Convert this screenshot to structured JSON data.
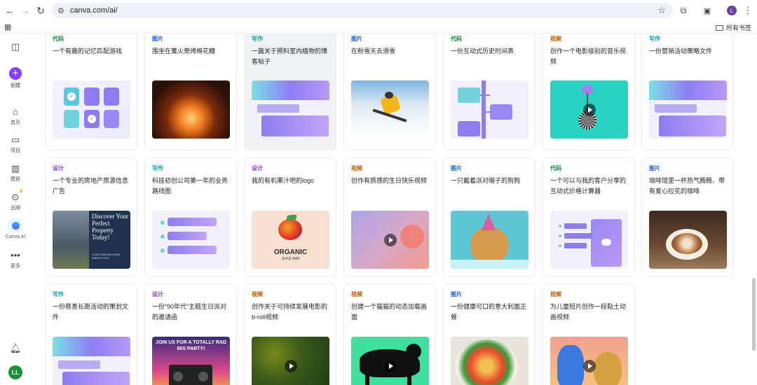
{
  "browser": {
    "url": "canva.com/ai/",
    "bookmarks_all": "所有书签",
    "profile_initial": "L"
  },
  "sidebar": {
    "create": "创建",
    "home": "首页",
    "projects": "项目",
    "templates": "模板",
    "brand": "品牌",
    "canva_ai": "Canva AI",
    "more": "更多",
    "user_initials": "LL"
  },
  "cards": [
    {
      "category": "代码",
      "title": "一个有趣的记忆匹配游戏",
      "thumb": "memory-game"
    },
    {
      "category": "图片",
      "title": "围坐在篝火旁烤棉花糖",
      "thumb": "campfire"
    },
    {
      "category": "写作",
      "title": "一篇关于照料室内植物的博客帖子",
      "thumb": "doc"
    },
    {
      "category": "图片",
      "title": "在粉雪天去滑雪",
      "thumb": "skier"
    },
    {
      "category": "代码",
      "title": "一份互动式历史时间表",
      "thumb": "timeline"
    },
    {
      "category": "视频",
      "title": "创作一个电影级别的音乐视频",
      "thumb": "discoball"
    },
    {
      "category": "写作",
      "title": "一份营销活动策略文件",
      "thumb": "doc"
    },
    {
      "category": "设计",
      "title": "一个专业的房地产房源信息广告",
      "thumb": "realestate",
      "thumb_text": "Discover Your Perfect Property Today!",
      "thumb_sub": "YOUR DREAM HOME AWAITS YOU"
    },
    {
      "category": "写作",
      "title": "科技初创公司第一年的业务路线图",
      "thumb": "list"
    },
    {
      "category": "设计",
      "title": "我的有机果汁吧的logo",
      "thumb": "logo",
      "thumb_text": "ORGANIC",
      "thumb_sub": "JUICE BAR"
    },
    {
      "category": "视频",
      "title": "创作有质感的生日快乐视频",
      "thumb": "balloons"
    },
    {
      "category": "图片",
      "title": "一只戴着派对帽子的狗狗",
      "thumb": "dog"
    },
    {
      "category": "代码",
      "title": "一个可以与我的客户分享的互动式价格计算器",
      "thumb": "calc"
    },
    {
      "category": "图片",
      "title": "咖啡馆里一杯热气腾腾、带有爱心拉花的咖啡",
      "thumb": "coffee"
    },
    {
      "category": "写作",
      "title": "一份慈善长跑活动的策划文件",
      "thumb": "doc"
    },
    {
      "category": "设计",
      "title": "一份“90年代”主题生日派对的邀请函",
      "thumb": "party90s",
      "thumb_text": "JOIN US FOR A TOTALLY RAD 90S PARTY!"
    },
    {
      "category": "视频",
      "title": "创作关于可持续发展电影的b-roll视频",
      "thumb": "forest"
    },
    {
      "category": "视频",
      "title": "创建一个猫猫的动态加载画面",
      "thumb": "cat"
    },
    {
      "category": "图片",
      "title": "一份健康可口的意大利面正餐",
      "thumb": "pasta"
    },
    {
      "category": "视频",
      "title": "为儿童短片创作一段黏土动画视频",
      "thumb": "clay"
    }
  ],
  "colors": {
    "代码": "#0e8a3a",
    "图片": "#1a5fd0",
    "写作": "#0a9aa8",
    "视频": "#b8600a",
    "设计": "#7a3fc0",
    "accent": "#8b3dff"
  }
}
